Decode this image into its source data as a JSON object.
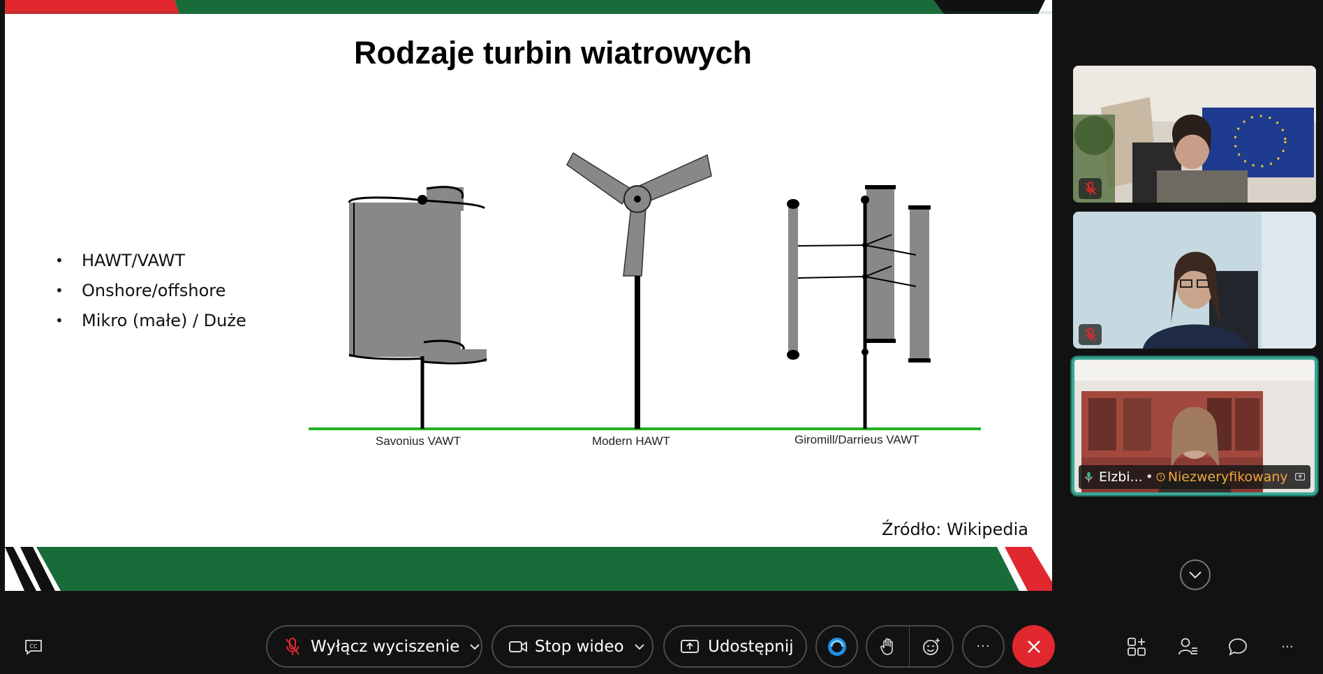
{
  "slide": {
    "title": "Rodzaje turbin wiatrowych",
    "bullets": [
      "HAWT/VAWT",
      "Onshore/offshore",
      "Mikro (małe) / Duże"
    ],
    "captions": [
      "Savonius VAWT",
      "Modern HAWT",
      "Giromill/Darrieus VAWT"
    ],
    "source": "Źródło: Wikipedia"
  },
  "participants": [
    {
      "muted": true
    },
    {
      "muted": true
    },
    {
      "name": "Elzbi...",
      "status": "Niezweryfikowany",
      "active_speaker": true
    }
  ],
  "toolbar": {
    "captions_icon": "closed-captions-icon",
    "mute_label": "Wyłącz wyciszenie",
    "video_label": "Stop wideo",
    "share_label": "Udostępnij",
    "more_label": "···"
  },
  "colors": {
    "accent_red": "#e0282e",
    "slide_green": "#1a6b3a",
    "active_tile_border": "#3aa795",
    "unverified": "#f2a73b"
  }
}
